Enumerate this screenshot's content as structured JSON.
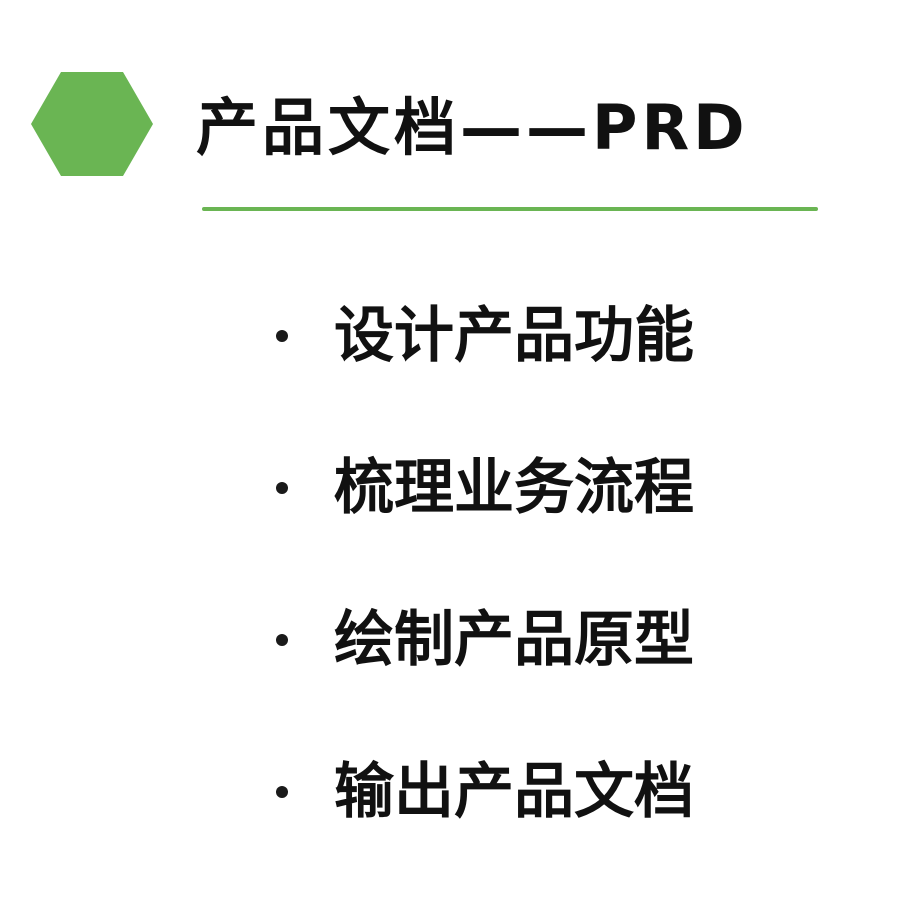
{
  "colors": {
    "accent": "#6ab553",
    "text": "#111111",
    "background": "#ffffff"
  },
  "header": {
    "icon": "hexagon-icon",
    "title": "产品文档——PRD"
  },
  "bullets": [
    {
      "text": "设计产品功能"
    },
    {
      "text": "梳理业务流程"
    },
    {
      "text": "绘制产品原型"
    },
    {
      "text": "输出产品文档"
    }
  ]
}
